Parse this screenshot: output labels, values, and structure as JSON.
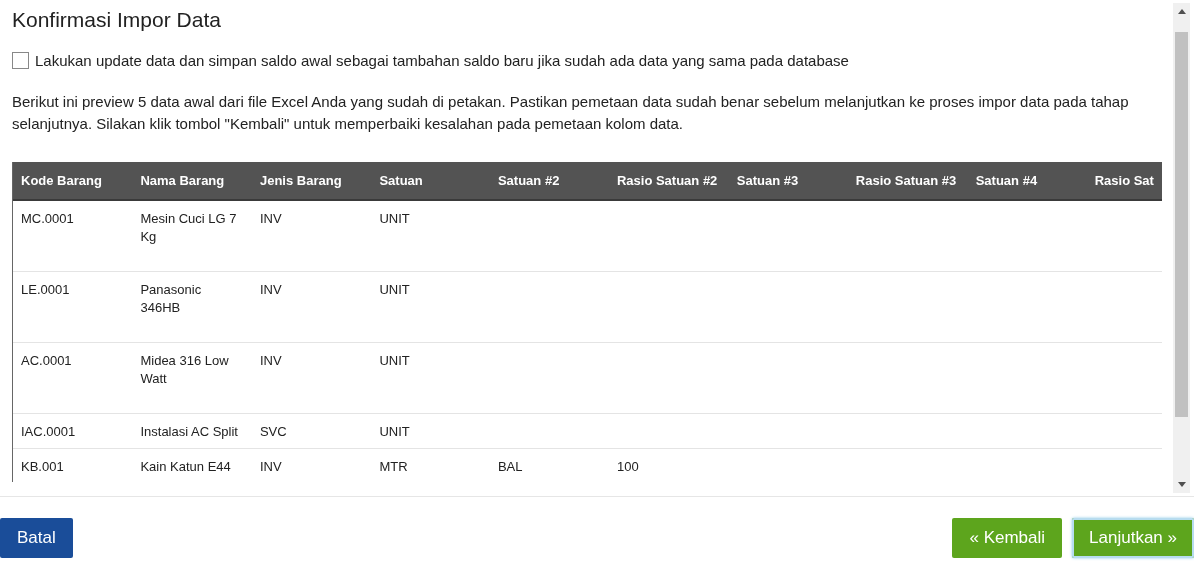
{
  "title": "Konfirmasi Impor Data",
  "update_option": {
    "label": "Lakukan update data dan simpan saldo awal sebagai tambahan saldo baru jika sudah ada data yang sama pada database",
    "checked": false
  },
  "description": "Berikut ini preview 5 data awal dari file Excel Anda yang sudah di petakan. Pastikan pemetaan data sudah benar sebelum melanjutkan ke proses impor data pada tahap selanjutnya. Silakan klik tombol \"Kembali\" untuk memperbaiki kesalahan pada pemetaan kolom data.",
  "table": {
    "columns": [
      "Kode Barang",
      "Nama Barang",
      "Jenis Barang",
      "Satuan",
      "Satuan #2",
      "Rasio Satuan #2",
      "Satuan #3",
      "Rasio Satuan #3",
      "Satuan #4",
      "Rasio Sat"
    ],
    "rows": [
      [
        "MC.0001",
        "Mesin Cuci LG 7 Kg",
        "INV",
        "UNIT",
        "",
        "",
        "",
        "",
        "",
        ""
      ],
      [
        "LE.0001",
        "Panasonic 346HB",
        "INV",
        "UNIT",
        "",
        "",
        "",
        "",
        "",
        ""
      ],
      [
        "AC.0001",
        "Midea 316 Low Watt",
        "INV",
        "UNIT",
        "",
        "",
        "",
        "",
        "",
        ""
      ],
      [
        "IAC.0001",
        "Instalasi AC Split",
        "SVC",
        "UNIT",
        "",
        "",
        "",
        "",
        "",
        ""
      ],
      [
        "KB.001",
        "Kain Katun E44",
        "INV",
        "MTR",
        "BAL",
        "100",
        "",
        "",
        "",
        ""
      ]
    ]
  },
  "buttons": [
    {
      "label": "Batal",
      "kind": "primary",
      "focused": false
    },
    {
      "label": "« Kembali",
      "kind": "success",
      "focused": false
    },
    {
      "label": "Lanjutkan »",
      "kind": "success",
      "focused": true
    }
  ]
}
